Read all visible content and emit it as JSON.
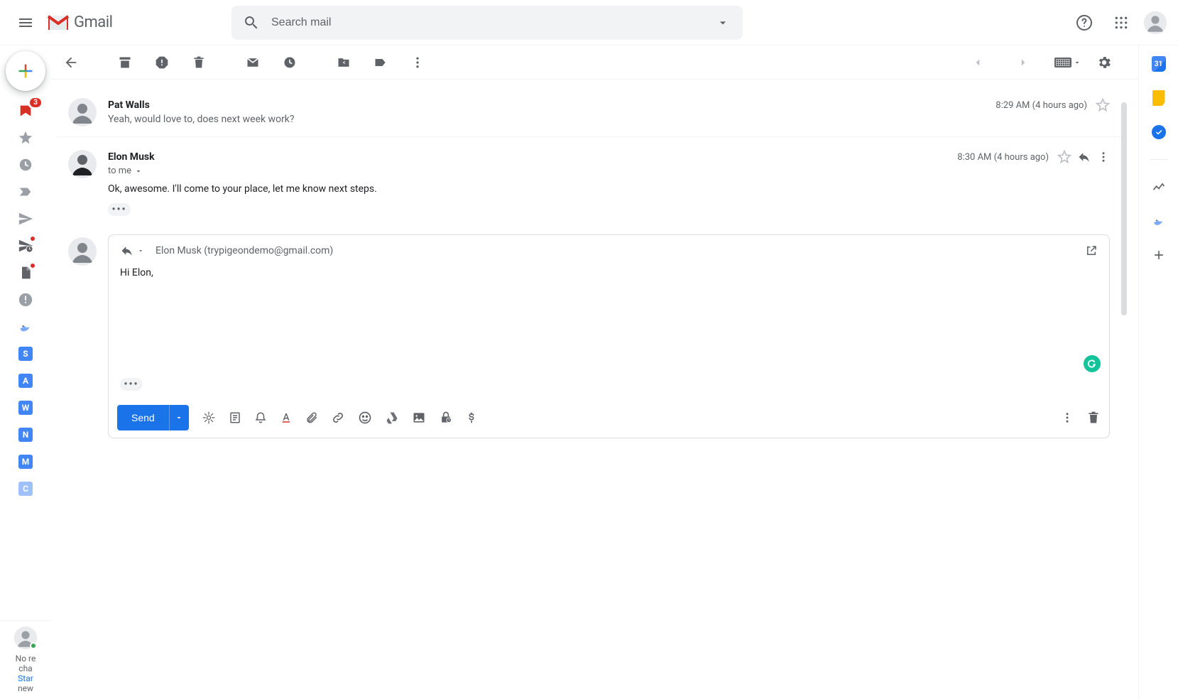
{
  "header": {
    "brand": "Gmail",
    "search_placeholder": "Search mail"
  },
  "nav": {
    "inbox_count": "3",
    "letters": [
      "S",
      "A",
      "W",
      "N",
      "M",
      "C"
    ]
  },
  "hangouts": {
    "line1": "No re",
    "line2": "cha",
    "link": "Star",
    "line4": "new "
  },
  "toolbar": {
    "paginator_prev": "‹",
    "paginator_next": "›"
  },
  "thread": {
    "messages": [
      {
        "sender": "Pat Walls",
        "time": "8:29 AM (4 hours ago)",
        "snippet": "Yeah, would love to, does next week work?"
      },
      {
        "sender": "Elon Musk",
        "time": "8:30 AM (4 hours ago)",
        "to_line": "to me",
        "body": "Ok, awesome. I'll come to your place, let me know next steps."
      }
    ]
  },
  "compose": {
    "recipients": "Elon Musk (trypigeondemo@gmail.com)",
    "body": "Hi Elon,",
    "send_label": "Send"
  },
  "side": {
    "calendar_day": "31"
  }
}
